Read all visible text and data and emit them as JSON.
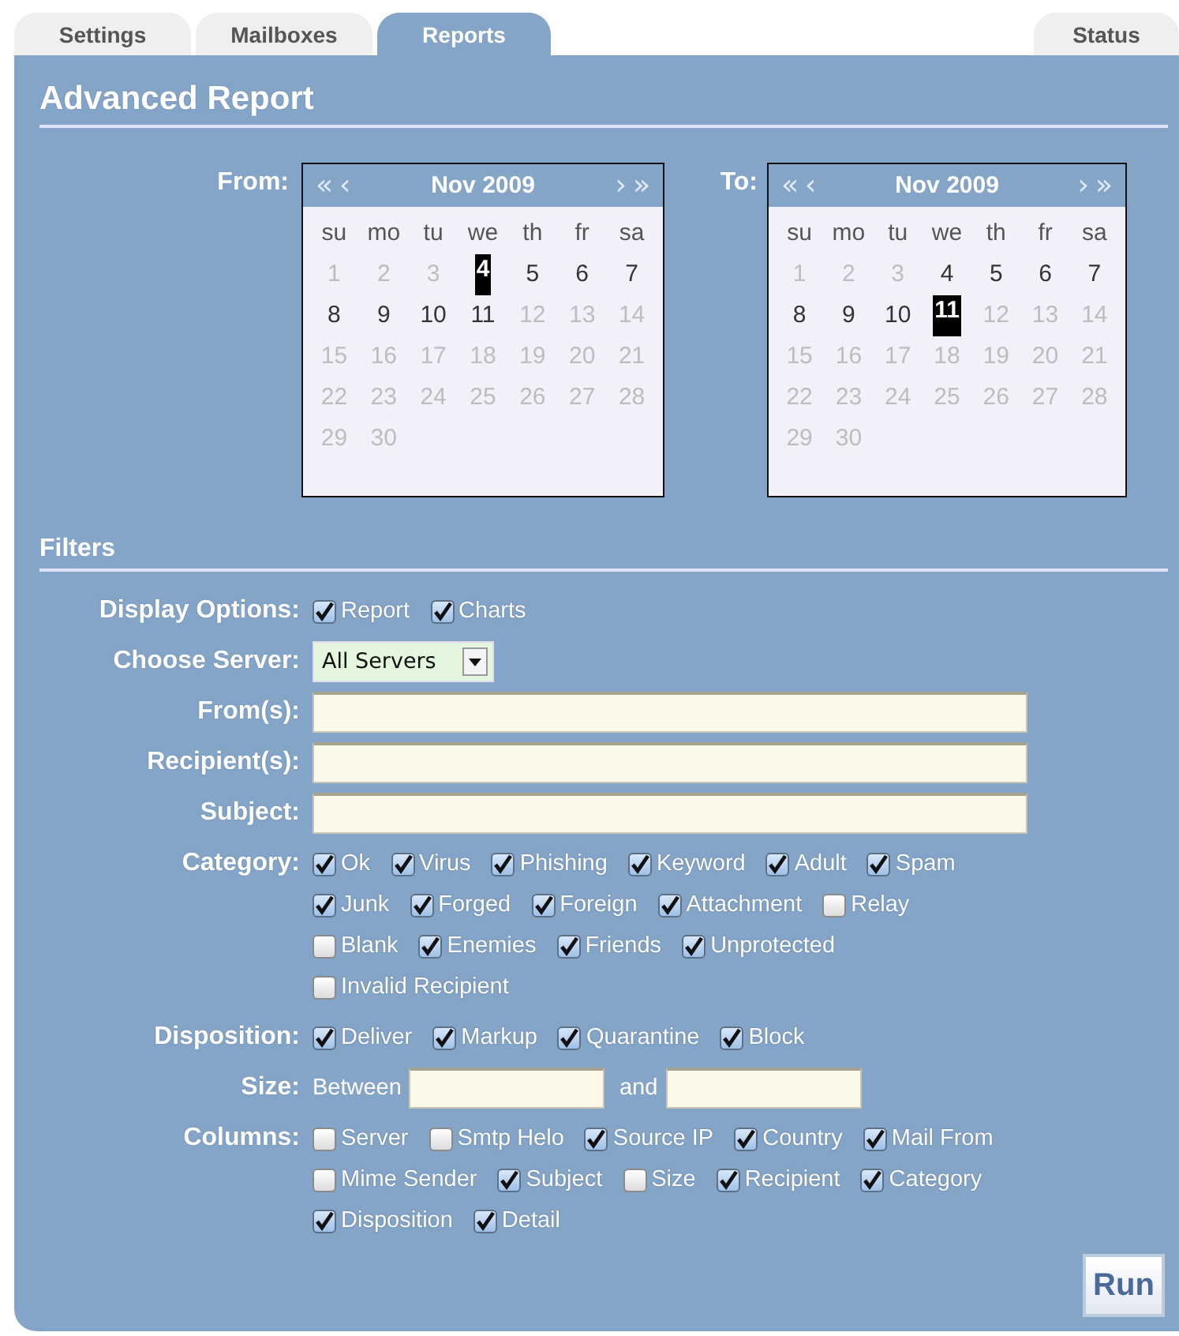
{
  "tabs": [
    {
      "label": "Settings",
      "selected": false
    },
    {
      "label": "Mailboxes",
      "selected": false
    },
    {
      "label": "Reports",
      "selected": true
    },
    {
      "label": "Status",
      "selected": false
    }
  ],
  "title": "Advanced Report",
  "calendars": [
    {
      "label": "From:",
      "month": "Nov 2009",
      "nav": [
        "«",
        "‹",
        "›",
        "»"
      ],
      "weekdays": [
        "su",
        "mo",
        "tu",
        "we",
        "th",
        "fr",
        "sa"
      ],
      "days": [
        {
          "label": "1",
          "in_range": false,
          "selected": false
        },
        {
          "label": "2",
          "in_range": false,
          "selected": false
        },
        {
          "label": "3",
          "in_range": false,
          "selected": false
        },
        {
          "label": "4",
          "in_range": true,
          "selected": true
        },
        {
          "label": "5",
          "in_range": true,
          "selected": false
        },
        {
          "label": "6",
          "in_range": true,
          "selected": false
        },
        {
          "label": "7",
          "in_range": true,
          "selected": false
        },
        {
          "label": "8",
          "in_range": true,
          "selected": false
        },
        {
          "label": "9",
          "in_range": true,
          "selected": false
        },
        {
          "label": "10",
          "in_range": true,
          "selected": false
        },
        {
          "label": "11",
          "in_range": true,
          "selected": false
        },
        {
          "label": "12",
          "in_range": false,
          "selected": false
        },
        {
          "label": "13",
          "in_range": false,
          "selected": false
        },
        {
          "label": "14",
          "in_range": false,
          "selected": false
        },
        {
          "label": "15",
          "in_range": false,
          "selected": false
        },
        {
          "label": "16",
          "in_range": false,
          "selected": false
        },
        {
          "label": "17",
          "in_range": false,
          "selected": false
        },
        {
          "label": "18",
          "in_range": false,
          "selected": false
        },
        {
          "label": "19",
          "in_range": false,
          "selected": false
        },
        {
          "label": "20",
          "in_range": false,
          "selected": false
        },
        {
          "label": "21",
          "in_range": false,
          "selected": false
        },
        {
          "label": "22",
          "in_range": false,
          "selected": false
        },
        {
          "label": "23",
          "in_range": false,
          "selected": false
        },
        {
          "label": "24",
          "in_range": false,
          "selected": false
        },
        {
          "label": "25",
          "in_range": false,
          "selected": false
        },
        {
          "label": "26",
          "in_range": false,
          "selected": false
        },
        {
          "label": "27",
          "in_range": false,
          "selected": false
        },
        {
          "label": "28",
          "in_range": false,
          "selected": false
        },
        {
          "label": "29",
          "in_range": false,
          "selected": false
        },
        {
          "label": "30",
          "in_range": false,
          "selected": false
        }
      ]
    },
    {
      "label": "To:",
      "month": "Nov 2009",
      "nav": [
        "«",
        "‹",
        "›",
        "»"
      ],
      "weekdays": [
        "su",
        "mo",
        "tu",
        "we",
        "th",
        "fr",
        "sa"
      ],
      "days": [
        {
          "label": "1",
          "in_range": false,
          "selected": false
        },
        {
          "label": "2",
          "in_range": false,
          "selected": false
        },
        {
          "label": "3",
          "in_range": false,
          "selected": false
        },
        {
          "label": "4",
          "in_range": true,
          "selected": false
        },
        {
          "label": "5",
          "in_range": true,
          "selected": false
        },
        {
          "label": "6",
          "in_range": true,
          "selected": false
        },
        {
          "label": "7",
          "in_range": true,
          "selected": false
        },
        {
          "label": "8",
          "in_range": true,
          "selected": false
        },
        {
          "label": "9",
          "in_range": true,
          "selected": false
        },
        {
          "label": "10",
          "in_range": true,
          "selected": false
        },
        {
          "label": "11",
          "in_range": true,
          "selected": true
        },
        {
          "label": "12",
          "in_range": false,
          "selected": false
        },
        {
          "label": "13",
          "in_range": false,
          "selected": false
        },
        {
          "label": "14",
          "in_range": false,
          "selected": false
        },
        {
          "label": "15",
          "in_range": false,
          "selected": false
        },
        {
          "label": "16",
          "in_range": false,
          "selected": false
        },
        {
          "label": "17",
          "in_range": false,
          "selected": false
        },
        {
          "label": "18",
          "in_range": false,
          "selected": false
        },
        {
          "label": "19",
          "in_range": false,
          "selected": false
        },
        {
          "label": "20",
          "in_range": false,
          "selected": false
        },
        {
          "label": "21",
          "in_range": false,
          "selected": false
        },
        {
          "label": "22",
          "in_range": false,
          "selected": false
        },
        {
          "label": "23",
          "in_range": false,
          "selected": false
        },
        {
          "label": "24",
          "in_range": false,
          "selected": false
        },
        {
          "label": "25",
          "in_range": false,
          "selected": false
        },
        {
          "label": "26",
          "in_range": false,
          "selected": false
        },
        {
          "label": "27",
          "in_range": false,
          "selected": false
        },
        {
          "label": "28",
          "in_range": false,
          "selected": false
        },
        {
          "label": "29",
          "in_range": false,
          "selected": false
        },
        {
          "label": "30",
          "in_range": false,
          "selected": false
        }
      ]
    }
  ],
  "filters_title": "Filters",
  "filters": [
    {
      "kind": "checks",
      "label": "Display Options:",
      "lines": [
        [
          {
            "label": "Report",
            "checked": true
          },
          {
            "label": "Charts",
            "checked": true
          }
        ]
      ]
    },
    {
      "kind": "select",
      "label": "Choose Server:",
      "value": "All Servers"
    },
    {
      "kind": "text",
      "label": "From(s):"
    },
    {
      "kind": "text",
      "label": "Recipient(s):"
    },
    {
      "kind": "text",
      "label": "Subject:"
    },
    {
      "kind": "checks",
      "label": "Category:",
      "lines": [
        [
          {
            "label": "Ok",
            "checked": true
          },
          {
            "label": "Virus",
            "checked": true
          },
          {
            "label": "Phishing",
            "checked": true
          },
          {
            "label": "Keyword",
            "checked": true
          },
          {
            "label": "Adult",
            "checked": true
          },
          {
            "label": "Spam",
            "checked": true
          }
        ],
        [
          {
            "label": "Junk",
            "checked": true
          },
          {
            "label": "Forged",
            "checked": true
          },
          {
            "label": "Foreign",
            "checked": true
          },
          {
            "label": "Attachment",
            "checked": true
          },
          {
            "label": "Relay",
            "checked": false
          }
        ],
        [
          {
            "label": "Blank",
            "checked": false
          },
          {
            "label": "Enemies",
            "checked": true
          },
          {
            "label": "Friends",
            "checked": true
          },
          {
            "label": "Unprotected",
            "checked": true
          }
        ],
        [
          {
            "label": "Invalid Recipient",
            "checked": false
          }
        ]
      ]
    },
    {
      "kind": "checks",
      "label": "Disposition:",
      "lines": [
        [
          {
            "label": "Deliver",
            "checked": true
          },
          {
            "label": "Markup",
            "checked": true
          },
          {
            "label": "Quarantine",
            "checked": true
          },
          {
            "label": "Block",
            "checked": true
          }
        ]
      ]
    },
    {
      "kind": "size",
      "label": "Size:",
      "prefix": "Between",
      "middle": "and"
    },
    {
      "kind": "checks",
      "label": "Columns:",
      "lines": [
        [
          {
            "label": "Server",
            "checked": false
          },
          {
            "label": "Smtp Helo",
            "checked": false
          },
          {
            "label": "Source IP",
            "checked": true
          },
          {
            "label": "Country",
            "checked": true
          },
          {
            "label": "Mail From",
            "checked": true
          }
        ],
        [
          {
            "label": "Mime Sender",
            "checked": false
          },
          {
            "label": "Subject",
            "checked": true
          },
          {
            "label": "Size",
            "checked": false
          },
          {
            "label": "Recipient",
            "checked": true
          },
          {
            "label": "Category",
            "checked": true
          }
        ],
        [
          {
            "label": "Disposition",
            "checked": true
          },
          {
            "label": "Detail",
            "checked": true
          }
        ]
      ]
    }
  ],
  "run_button": "Run"
}
